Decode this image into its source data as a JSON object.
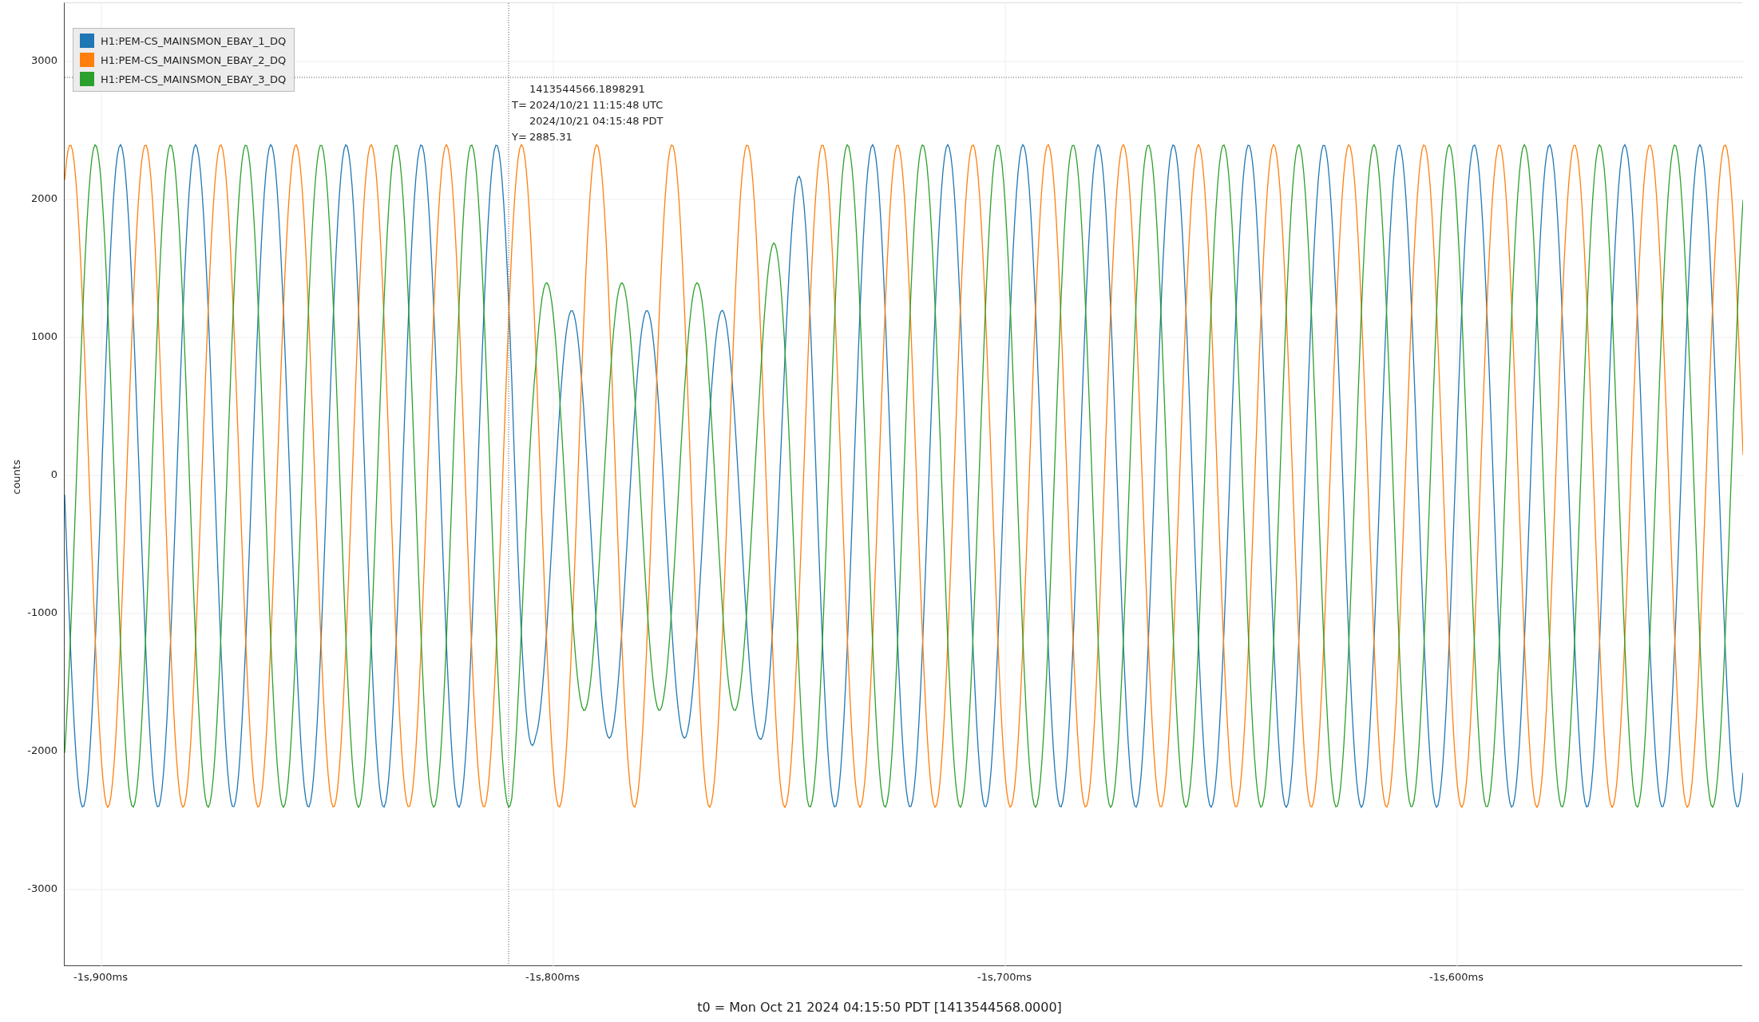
{
  "plot": {
    "y_axis": {
      "label": "counts",
      "ticks": [
        "3000",
        "2000",
        "1000",
        "0",
        "-1000",
        "-2000",
        "-3000"
      ]
    },
    "x_axis": {
      "ticks": [
        "-1s,900ms",
        "-1s,800ms",
        "-1s,700ms",
        "-1s,600ms"
      ]
    },
    "legend": [
      {
        "name": "H1:PEM-CS_MAINSMON_EBAY_1_DQ",
        "color": "#1f77b4"
      },
      {
        "name": "H1:PEM-CS_MAINSMON_EBAY_2_DQ",
        "color": "#ff7f0e"
      },
      {
        "name": "H1:PEM-CS_MAINSMON_EBAY_3_DQ",
        "color": "#2ca02c"
      }
    ],
    "cursor": {
      "readout": [
        {
          "text": "1413544566.1898291"
        },
        {
          "prefix": "T=",
          "text": "2024/10/21 11:15:48 UTC"
        },
        {
          "text": "2024/10/21 04:15:48 PDT"
        },
        {
          "prefix": "Y=",
          "text": "2885.31"
        }
      ]
    }
  },
  "footer": "t0 = Mon Oct 21 2024 04:15:50 PDT [1413544568.0000]"
}
